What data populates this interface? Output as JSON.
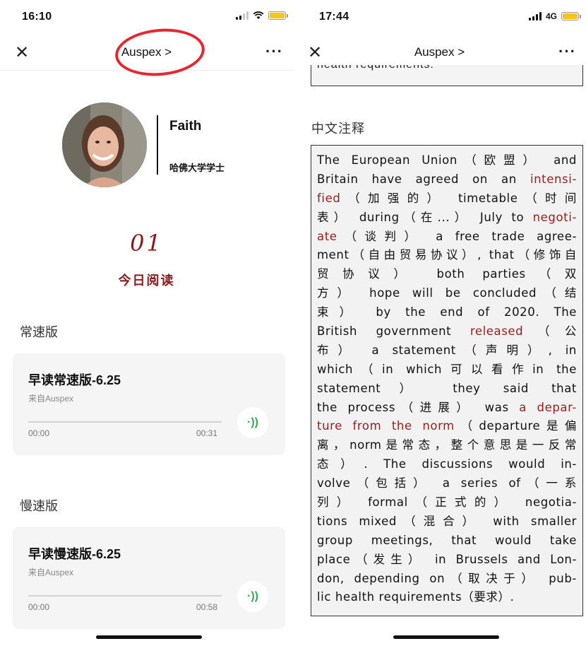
{
  "left_screen": {
    "status": {
      "time": "16:10"
    },
    "nav": {
      "title": "Auspex >"
    },
    "profile": {
      "name": "Faith",
      "degree": "哈佛大学学士"
    },
    "issue": {
      "number": "01",
      "label": "今日阅读"
    },
    "sections": [
      {
        "label": "常速版",
        "card": {
          "title": "早读常速版-6.25",
          "source": "来自Auspex",
          "current_time": "00:00",
          "duration": "00:31",
          "progress": 0
        }
      },
      {
        "label": "慢速版",
        "card": {
          "title": "早读慢速版-6.25",
          "source": "来自Auspex",
          "current_time": "00:00",
          "duration": "00:58",
          "progress": 0
        }
      }
    ]
  },
  "right_screen": {
    "status": {
      "time": "17:44",
      "network": "4G"
    },
    "nav": {
      "title": "Auspex >"
    },
    "previous_box_tail": "health requirements.",
    "heading": "中文注释",
    "annotation_lines": [
      [
        [
          "The European Union（欧盟） and",
          ""
        ]
      ],
      [
        [
          "Britain have agreed on an ",
          ""
        ],
        [
          "intensi-",
          "hl"
        ]
      ],
      [
        [
          "fied",
          "hl"
        ],
        [
          "（加强的） timetable（时间",
          ""
        ]
      ],
      [
        [
          "表） during（在...） July to ",
          ""
        ],
        [
          "negoti-",
          "hl"
        ]
      ],
      [
        [
          "ate",
          "hl"
        ],
        [
          "（谈判） a free trade agree-",
          ""
        ]
      ],
      [
        [
          "ment（自由贸易协议）, that（修饰自",
          ""
        ]
      ],
      [
        [
          "贸协议） both parties（双",
          ""
        ]
      ],
      [
        [
          "方） hope will be concluded（结",
          ""
        ]
      ],
      [
        [
          "束） by the end of 2020. The",
          ""
        ]
      ],
      [
        [
          "British government ",
          ""
        ],
        [
          "released",
          "hl"
        ],
        [
          "（公",
          ""
        ]
      ],
      [
        [
          "布） a statement（声明）, in",
          ""
        ]
      ],
      [
        [
          "which（in which可以看作in the",
          ""
        ]
      ],
      [
        [
          "statement） they said that",
          ""
        ]
      ],
      [
        [
          "the process（进展） was ",
          ""
        ],
        [
          "a depar-",
          "hl"
        ]
      ],
      [
        [
          "ture from the norm",
          "hl"
        ],
        [
          "（departure是偏",
          ""
        ]
      ],
      [
        [
          "离，norm是常态，整个意思是一反常",
          ""
        ]
      ],
      [
        [
          "态）. The discussions would in-",
          ""
        ]
      ],
      [
        [
          "volve（包括） a series of（一系",
          ""
        ]
      ],
      [
        [
          "列） formal（正式的） negotia-",
          ""
        ]
      ],
      [
        [
          "tions mixed（混合） with smaller",
          ""
        ]
      ],
      [
        [
          "group meetings, that would take",
          ""
        ]
      ],
      [
        [
          "place（发生） in Brussels and Lon-",
          ""
        ]
      ],
      [
        [
          "don, depending on（取决于） pub-",
          ""
        ]
      ],
      [
        [
          "lic health requirements（要求）.",
          ""
        ]
      ]
    ]
  },
  "colors": {
    "accent_red": "#8b1a1a",
    "highlight_red": "#9b1c1c",
    "circle_red": "#e8262f",
    "play_green": "#2fae52",
    "battery_yellow": "#f5c518"
  },
  "icons": [
    "close-icon",
    "more-icon",
    "signal-icon",
    "wifi-icon",
    "battery-icon",
    "audio-play-icon"
  ]
}
